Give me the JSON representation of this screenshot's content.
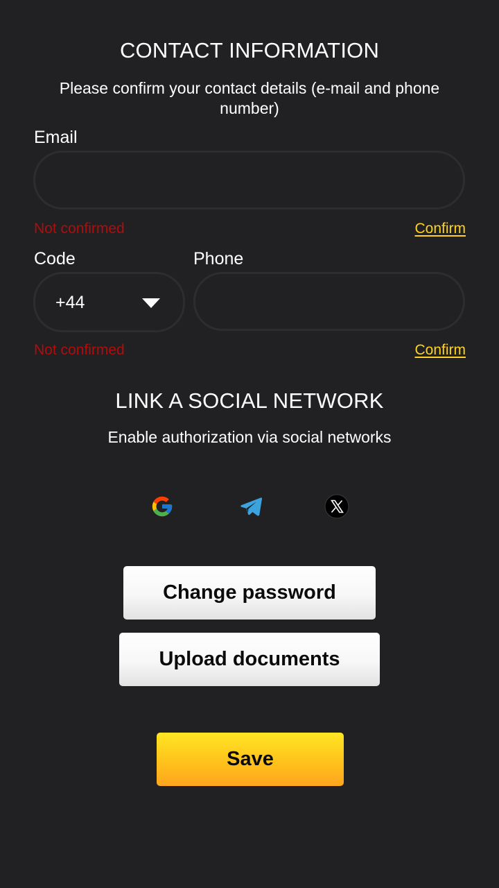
{
  "contact": {
    "title": "CONTACT INFORMATION",
    "subtitle_line1": "Please confirm your contact details (e-mail and phone",
    "subtitle_line2": "number)",
    "email": {
      "label": "Email",
      "value": "",
      "status": "Not confirmed",
      "confirm_label": "Confirm"
    },
    "phone": {
      "code_label": "Code",
      "code_value": "+44",
      "phone_label": "Phone",
      "value": "",
      "status": "Not confirmed",
      "confirm_label": "Confirm"
    }
  },
  "social": {
    "title": "LINK A SOCIAL NETWORK",
    "subtitle": "Enable authorization via social networks",
    "networks": [
      "google-icon",
      "telegram-icon",
      "x-icon"
    ]
  },
  "actions": {
    "change_password": "Change password",
    "upload_documents": "Upload documents",
    "save": "Save"
  },
  "colors": {
    "background": "#212123",
    "not_confirmed": "#b00d0d",
    "confirm_link": "#ffd21f",
    "save_button": "#ffc21c"
  }
}
